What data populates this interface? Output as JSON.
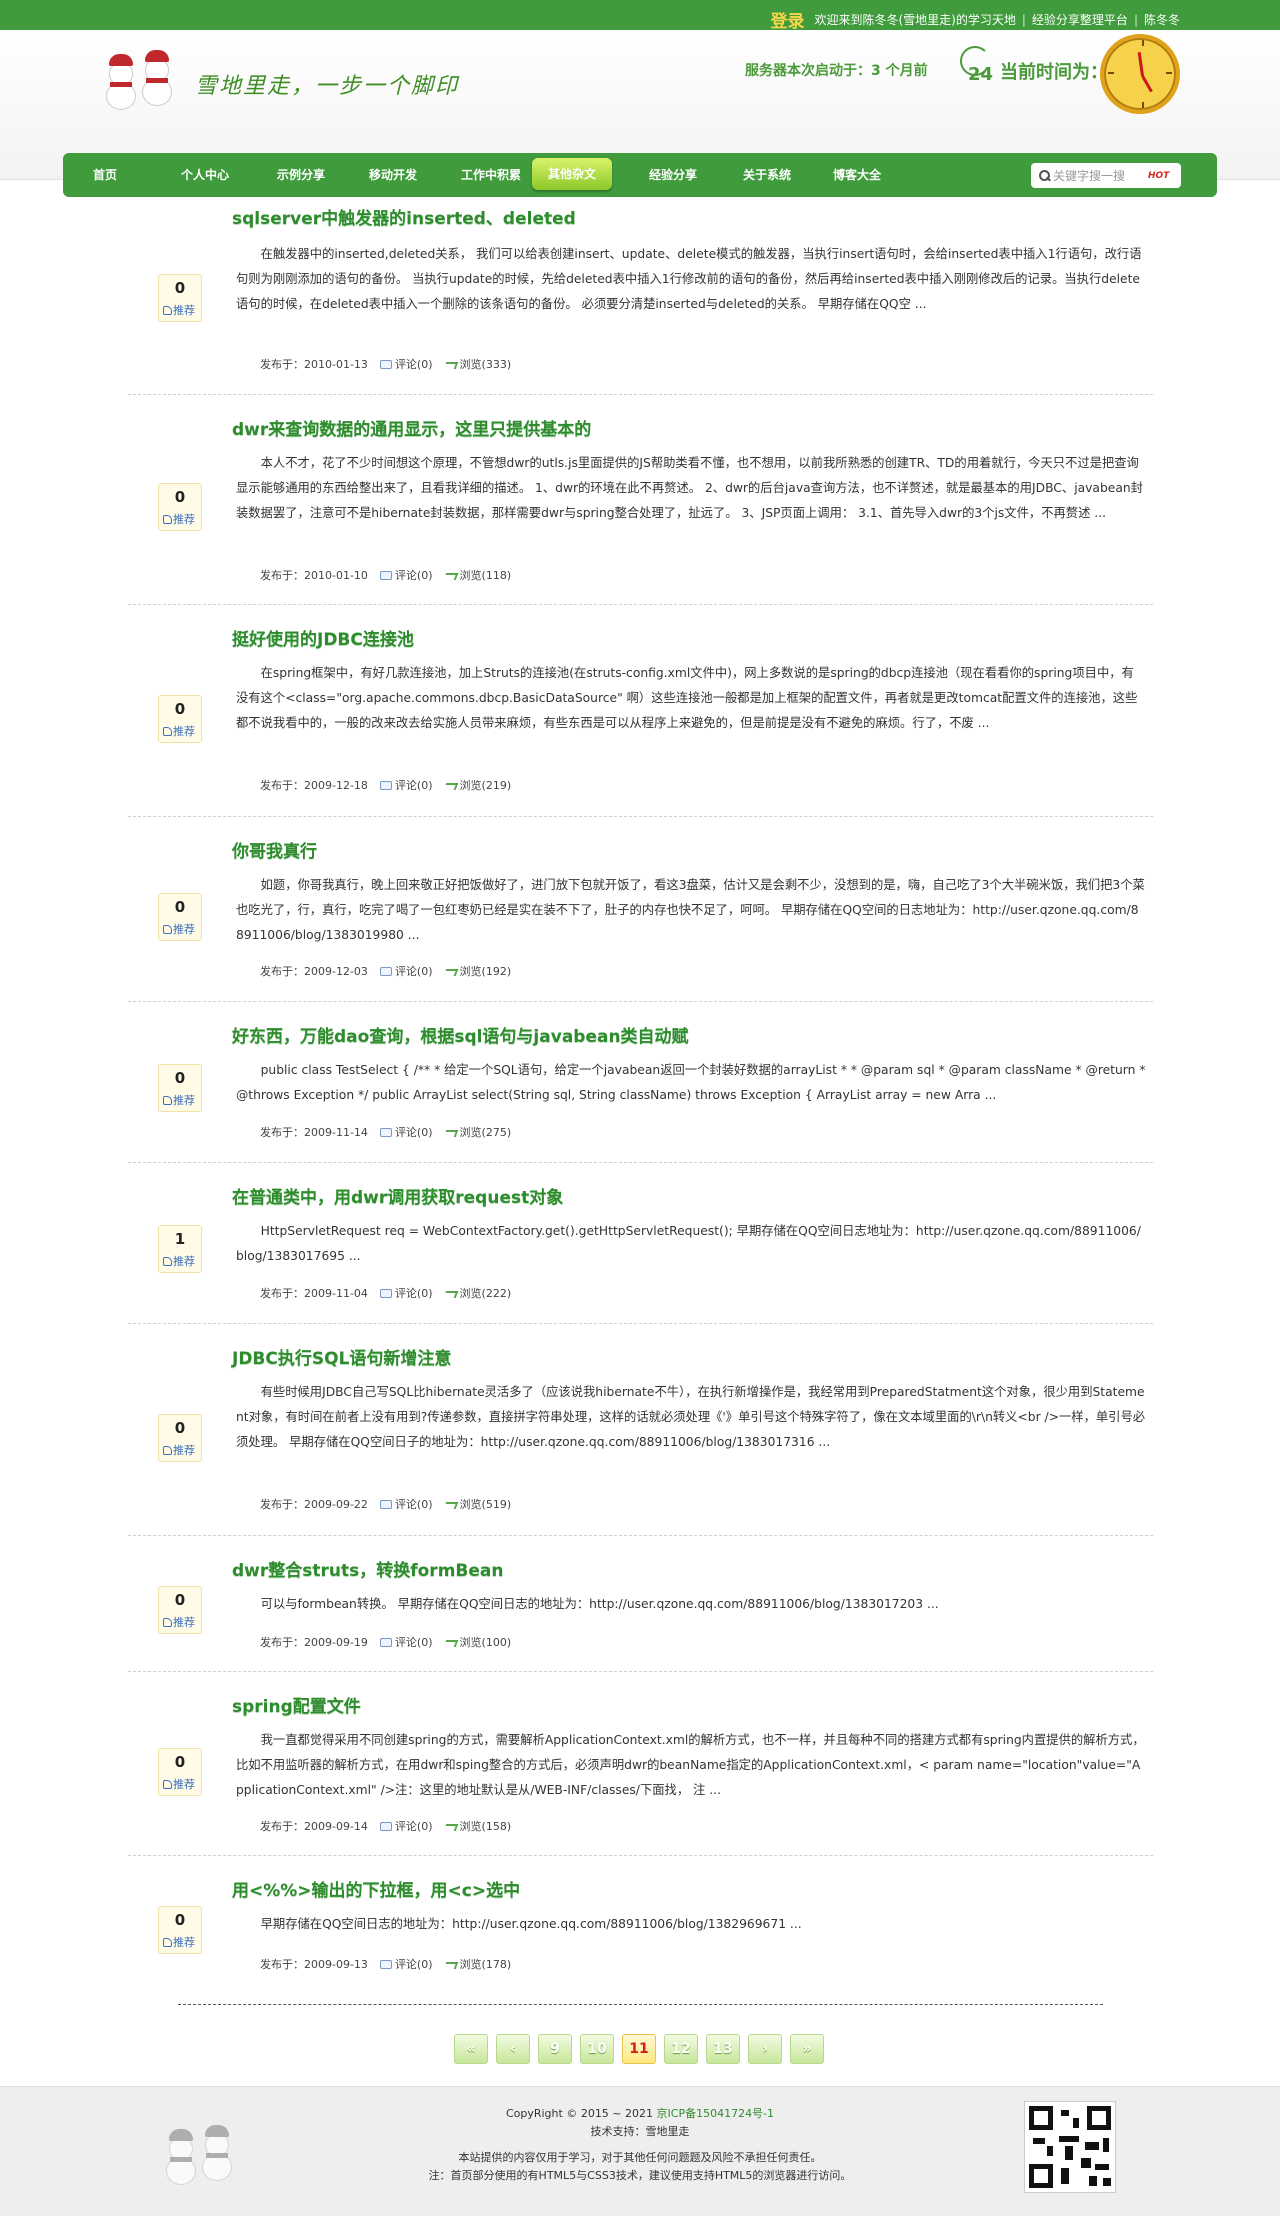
{
  "topbar": {
    "login": "登录",
    "welcome": "欢迎来到陈冬冬(雪地里走)的学习天地",
    "platform": "经验分享整理平台",
    "owner": "陈冬冬"
  },
  "header": {
    "logo_text": "雪地里走，一步一个脚印",
    "server_label": "服务器本次启动于：3 个月前",
    "clock_icon_num": "24",
    "time_label": "当前时间为："
  },
  "nav": {
    "items": [
      "首页",
      "个人中心",
      "示例分享",
      "移动开发",
      "工作中积累",
      "其他杂文",
      "经验分享",
      "关于系统",
      "博客大全"
    ],
    "active_index": 5
  },
  "search": {
    "placeholder": "关键字搜一搜",
    "hot": "HOT"
  },
  "posts": [
    {
      "title": "sqlserver中触发器的inserted、deleted",
      "body": "在触发器中的inserted,deleted关系， 我们可以给表创建insert、update、delete模式的触发器，当执行insert语句时，会给inserted表中插入1行语句，改行语句则为刚刚添加的语句的备份。 当执行update的时候，先给deleted表中插入1行修改前的语句的备份，然后再给inserted表中插入刚刚修改后的记录。当执行delete语句的时候，在deleted表中插入一个删除的该条语句的备份。 必须要分清楚inserted与deleted的关系。 早期存储在QQ空 ...",
      "date": "发布于：2010-01-13",
      "comments": "评论(0)",
      "views": "浏览(333)",
      "votes": "0"
    },
    {
      "title": "dwr来查询数据的通用显示，这里只提供基本的",
      "body": "本人不才，花了不少时间想这个原理，不管想dwr的utls.js里面提供的JS帮助类看不懂，也不想用，以前我所熟悉的创建TR、TD的用着就行，今天只不过是把查询显示能够通用的东西给整出来了，且看我详细的描述。 1、dwr的环境在此不再赘述。 2、dwr的后台java查询方法，也不详赘述，就是最基本的用JDBC、javabean封装数据罢了，注意可不是hibernate封装数据，那样需要dwr与spring整合处理了，扯远了。 3、JSP页面上调用： 3.1、首先导入dwr的3个js文件，不再赘述 ...",
      "date": "发布于：2010-01-10",
      "comments": "评论(0)",
      "views": "浏览(118)",
      "votes": "0"
    },
    {
      "title": "挺好使用的JDBC连接池",
      "body": "在spring框架中，有好几款连接池，加上Struts的连接池(在struts-config.xml文件中)，网上多数说的是spring的dbcp连接池（现在看看你的spring项目中，有没有这个<class=\"org.apache.commons.dbcp.BasicDataSource\" 啊）这些连接池一般都是加上框架的配置文件，再者就是更改tomcat配置文件的连接池，这些都不说我看中的，一般的改来改去给实施人员带来麻烦，有些东西是可以从程序上来避免的，但是前提是没有不避免的麻烦。行了，不废 ...",
      "date": "发布于：2009-12-18",
      "comments": "评论(0)",
      "views": "浏览(219)",
      "votes": "0"
    },
    {
      "title": "你哥我真行",
      "body": "如题，你哥我真行，晚上回来敬正好把饭做好了，进门放下包就开饭了，看这3盘菜，估计又是会剩不少，没想到的是，嗨，自己吃了3个大半碗米饭，我们把3个菜也吃光了，行，真行，吃完了喝了一包红枣奶已经是实在装不下了，肚子的内存也快不足了，呵呵。 早期存储在QQ空间的日志地址为：http://user.qzone.qq.com/88911006/blog/1383019980 ...",
      "date": "发布于：2009-12-03",
      "comments": "评论(0)",
      "views": "浏览(192)",
      "votes": "0"
    },
    {
      "title": "好东西，万能dao查询，根据sql语句与javabean类自动赋",
      "body": "public class TestSelect { /** * 给定一个SQL语句，给定一个javabean返回一个封装好数据的arrayList * * @param sql * @param className * @return * @throws Exception */ public ArrayList select(String sql, String className) throws Exception { ArrayList array = new Arra ...",
      "date": "发布于：2009-11-14",
      "comments": "评论(0)",
      "views": "浏览(275)",
      "votes": "0"
    },
    {
      "title": "在普通类中，用dwr调用获取request对象",
      "body": "HttpServletRequest req = WebContextFactory.get().getHttpServletRequest(); 早期存储在QQ空间日志地址为：http://user.qzone.qq.com/88911006/blog/1383017695 ...",
      "date": "发布于：2009-11-04",
      "comments": "评论(0)",
      "views": "浏览(222)",
      "votes": "1"
    },
    {
      "title": "JDBC执行SQL语句新增注意",
      "body": "有些时候用JDBC自己写SQL比hibernate灵活多了（应该说我hibernate不牛），在执行新增操作是，我经常用到PreparedStatment这个对象，很少用到Statement对象，有时间在前者上没有用到?传递参数，直接拼字符串处理，这样的话就必须处理《'》单引号这个特殊字符了，像在文本域里面的\\r\\n转义<br />一样，单引号必须处理。 早期存储在QQ空间日子的地址为：http://user.qzone.qq.com/88911006/blog/1383017316 ...",
      "date": "发布于：2009-09-22",
      "comments": "评论(0)",
      "views": "浏览(519)",
      "votes": "0"
    },
    {
      "title": "dwr整合struts，转换formBean",
      "body": "可以与formbean转换。 早期存储在QQ空间日志的地址为：http://user.qzone.qq.com/88911006/blog/1383017203 ...",
      "date": "发布于：2009-09-19",
      "comments": "评论(0)",
      "views": "浏览(100)",
      "votes": "0"
    },
    {
      "title": "spring配置文件",
      "body": "我一直都觉得采用不同创建spring的方式，需要解析ApplicationContext.xml的解析方式，也不一样，并且每种不同的搭建方式都有spring内置提供的解析方式，比如不用监听器的解析方式，在用dwr和sping整合的方式后，必须声明dwr的beanName指定的ApplicationContext.xml，< param name=\"location\"value=\"ApplicationContext.xml\" />注：这里的地址默认是从/WEB-INF/classes/下面找， 注 ...",
      "date": "发布于：2009-09-14",
      "comments": "评论(0)",
      "views": "浏览(158)",
      "votes": "0"
    },
    {
      "title": "用<%%>输出的下拉框，用<c>选中",
      "body": "早期存储在QQ空间日志的地址为：http://user.qzone.qq.com/88911006/blog/1382969671 ...",
      "date": "发布于：2009-09-13",
      "comments": "评论(0)",
      "views": "浏览(178)",
      "votes": "0"
    }
  ],
  "vote_label": "推荐",
  "pagination": {
    "first": "«",
    "prev": "‹",
    "pages": [
      "9",
      "10",
      "11",
      "12",
      "13"
    ],
    "current": "11",
    "next": "›",
    "last": "»"
  },
  "footer": {
    "copyright": "CopyRight © 2015 ~ 2021",
    "icp": "京ICP备15041724号-1",
    "support": "技术支持：雪地里走",
    "disclaimer": "本站提供的内容仅用于学习，对于其他任何问题题及风险不承担任何责任。",
    "note": "注：首页部分使用的有HTML5与CSS3技术，建议使用支持HTML5的浏览器进行访问。"
  },
  "colors": {
    "brand_green": "#3f9b3c",
    "title_green": "#2e8b2e",
    "current_page_red": "#d51f1f"
  }
}
